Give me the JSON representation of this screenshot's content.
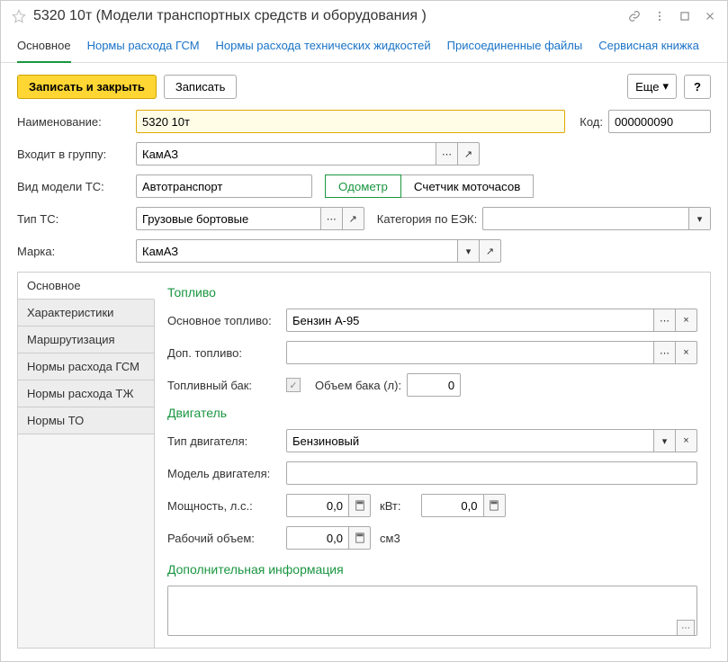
{
  "title": "5320 10т (Модели транспортных средств и оборудования )",
  "topTabs": {
    "main": "Основное",
    "gsm": "Нормы расхода ГСМ",
    "fluids": "Нормы расхода технических жидкостей",
    "files": "Присоединенные файлы",
    "service": "Сервисная книжка"
  },
  "toolbar": {
    "saveClose": "Записать и закрыть",
    "save": "Записать",
    "more": "Еще",
    "help": "?"
  },
  "labels": {
    "name": "Наименование:",
    "code": "Код:",
    "group": "Входит в группу:",
    "modelType": "Вид модели ТС:",
    "tsType": "Тип ТС:",
    "eekCat": "Категория по ЕЭК:",
    "brand": "Марка:"
  },
  "values": {
    "name": "5320 10т",
    "code": "000000090",
    "group": "КамАЗ",
    "modelType": "Автотранспорт",
    "tsType": "Грузовые бортовые",
    "eekCat": "",
    "brand": "КамАЗ"
  },
  "seg": {
    "odometer": "Одометр",
    "motohours": "Счетчик моточасов"
  },
  "sideTabs": {
    "main": "Основное",
    "chars": "Характеристики",
    "routing": "Маршрутизация",
    "gsm": "Нормы расхода ГСМ",
    "tj": "Нормы расхода ТЖ",
    "to": "Нормы ТО"
  },
  "sections": {
    "fuel": "Топливо",
    "engine": "Двигатель",
    "additional": "Дополнительная информация"
  },
  "fuel": {
    "mainLabel": "Основное топливо:",
    "mainValue": "Бензин А-95",
    "addLabel": "Доп. топливо:",
    "addValue": "",
    "tankLabel": "Топливный бак:",
    "volumeLabel": "Объем бака (л):",
    "volumeValue": "0"
  },
  "engine": {
    "typeLabel": "Тип двигателя:",
    "typeValue": "Бензиновый",
    "modelLabel": "Модель двигателя:",
    "modelValue": "",
    "powerLabel": "Мощность, л.с.:",
    "powerHp": "0,0",
    "kwtLabel": "кВт:",
    "powerKwt": "0,0",
    "displLabel": "Рабочий объем:",
    "displValue": "0,0",
    "cm3": "см3"
  },
  "additional": {
    "text": ""
  },
  "glyphs": {
    "dots": "⋯",
    "open": "↗",
    "down": "▾",
    "x": "×",
    "check": "✓",
    "max": "⛶",
    "close": "✕"
  }
}
